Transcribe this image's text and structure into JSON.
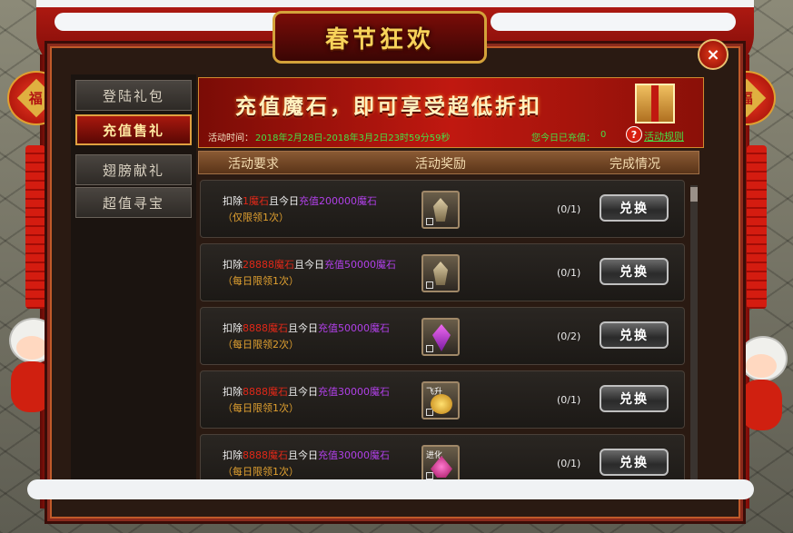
{
  "window": {
    "title": "春节狂欢",
    "close_icon": "×"
  },
  "lanterns": {
    "char": "福"
  },
  "sidebar": {
    "items": [
      {
        "label": "登陆礼包",
        "active": false
      },
      {
        "label": "充值售礼",
        "active": true
      },
      {
        "label": "翅膀献礼",
        "active": false
      },
      {
        "label": "超值寻宝",
        "active": false
      }
    ]
  },
  "banner": {
    "headline": "充值魔石，即可享受超低折扣",
    "time_label": "活动时间：",
    "time_value": "2018年2月28日-2018年3月2日23时59分59秒",
    "recharge_label": "您今日已充值：",
    "recharge_value": "0",
    "help_icon": "?",
    "rules_link": "活动规则"
  },
  "table": {
    "headers": [
      "活动要求",
      "活动奖励",
      "完成情况"
    ],
    "rows": [
      {
        "deduct_prefix": "扣除",
        "deduct_amount": "1魔石",
        "mid": "且今日",
        "recharge": "充值200000魔石",
        "limit": "（仅限领1次）",
        "reward_icon": "medal-icon",
        "reward_tag": "",
        "progress": "(0/1)",
        "button": "兑换"
      },
      {
        "deduct_prefix": "扣除",
        "deduct_amount": "28888魔石",
        "mid": "且今日",
        "recharge": "充值50000魔石",
        "limit": "（每日限领1次）",
        "reward_icon": "medal-icon",
        "reward_tag": "",
        "progress": "(0/1)",
        "button": "兑换"
      },
      {
        "deduct_prefix": "扣除",
        "deduct_amount": "8888魔石",
        "mid": "且今日",
        "recharge": "充值50000魔石",
        "limit": "（每日限领2次）",
        "reward_icon": "gem-icon",
        "reward_tag": "",
        "progress": "(0/2)",
        "button": "兑换"
      },
      {
        "deduct_prefix": "扣除",
        "deduct_amount": "8888魔石",
        "mid": "且今日",
        "recharge": "充值30000魔石",
        "limit": "（每日限领1次）",
        "reward_icon": "flower-icon",
        "reward_tag": "飞升",
        "progress": "(0/1)",
        "button": "兑换"
      },
      {
        "deduct_prefix": "扣除",
        "deduct_amount": "8888魔石",
        "mid": "且今日",
        "recharge": "充值30000魔石",
        "limit": "（每日限领1次）",
        "reward_icon": "crystal-icon",
        "reward_tag": "进化",
        "progress": "(0/1)",
        "button": "兑换"
      }
    ]
  },
  "colors": {
    "accent_red": "#c01810",
    "gold": "#f7d35a",
    "green_text": "#46e046",
    "deduct_red": "#e02818",
    "recharge_purple": "#b040e8",
    "limit_orange": "#e0a030"
  }
}
